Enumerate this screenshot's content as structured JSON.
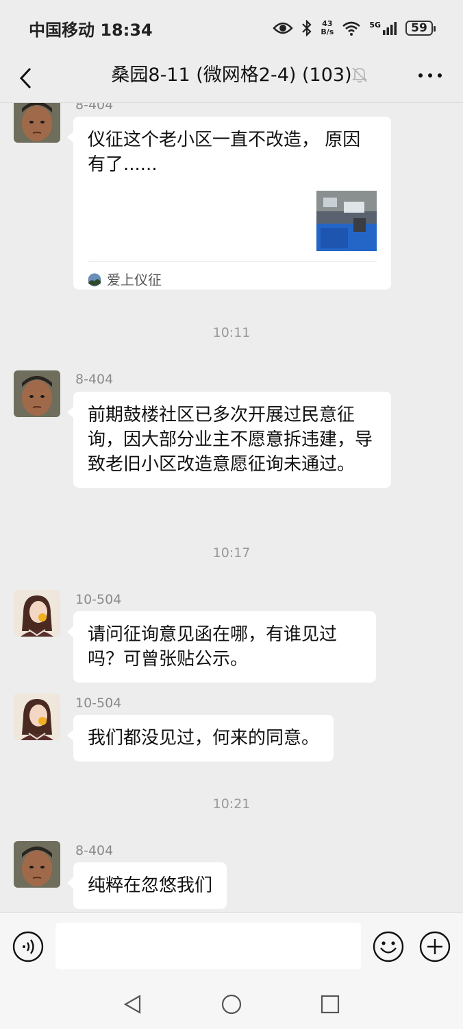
{
  "status_bar": {
    "carrier_time": "中国移动 18:34",
    "net_speed_value": "43",
    "net_speed_unit": "B/s",
    "network": "5G",
    "battery": "59"
  },
  "header": {
    "title": "桑园8-11 (微网格2-4) (103)"
  },
  "messages": [
    {
      "sender": "8-404",
      "text": "仪征这个老小区一直不改造， 原因有了......",
      "link_source": "爱上仪征"
    },
    {
      "time": "10:11"
    },
    {
      "sender": "8-404",
      "text": "前期鼓楼社区已多次开展过民意征询，因大部分业主不愿意拆违建，导致老旧小区改造意愿征询未通过。"
    },
    {
      "time": "10:17"
    },
    {
      "sender": "10-504",
      "text": "请问征询意见函在哪，有谁见过吗？可曾张贴公示。"
    },
    {
      "sender": "10-504",
      "text": "我们都没见过，何来的同意。"
    },
    {
      "time": "10:21"
    },
    {
      "sender": "8-404",
      "text": "纯粹在忽悠我们"
    }
  ],
  "input": {
    "value": "",
    "placeholder": ""
  },
  "colors": {
    "background": "#ededed",
    "bubble": "#ffffff",
    "timestamp": "#9a9a9a"
  },
  "icons": [
    "back-arrow-icon",
    "mute-bell-icon",
    "more-dots-icon",
    "voice-icon",
    "emoji-icon",
    "plus-icon",
    "nav-back-icon",
    "nav-home-icon",
    "nav-recent-icon",
    "eye-icon",
    "bluetooth-icon",
    "wifi-icon",
    "signal-icon"
  ]
}
